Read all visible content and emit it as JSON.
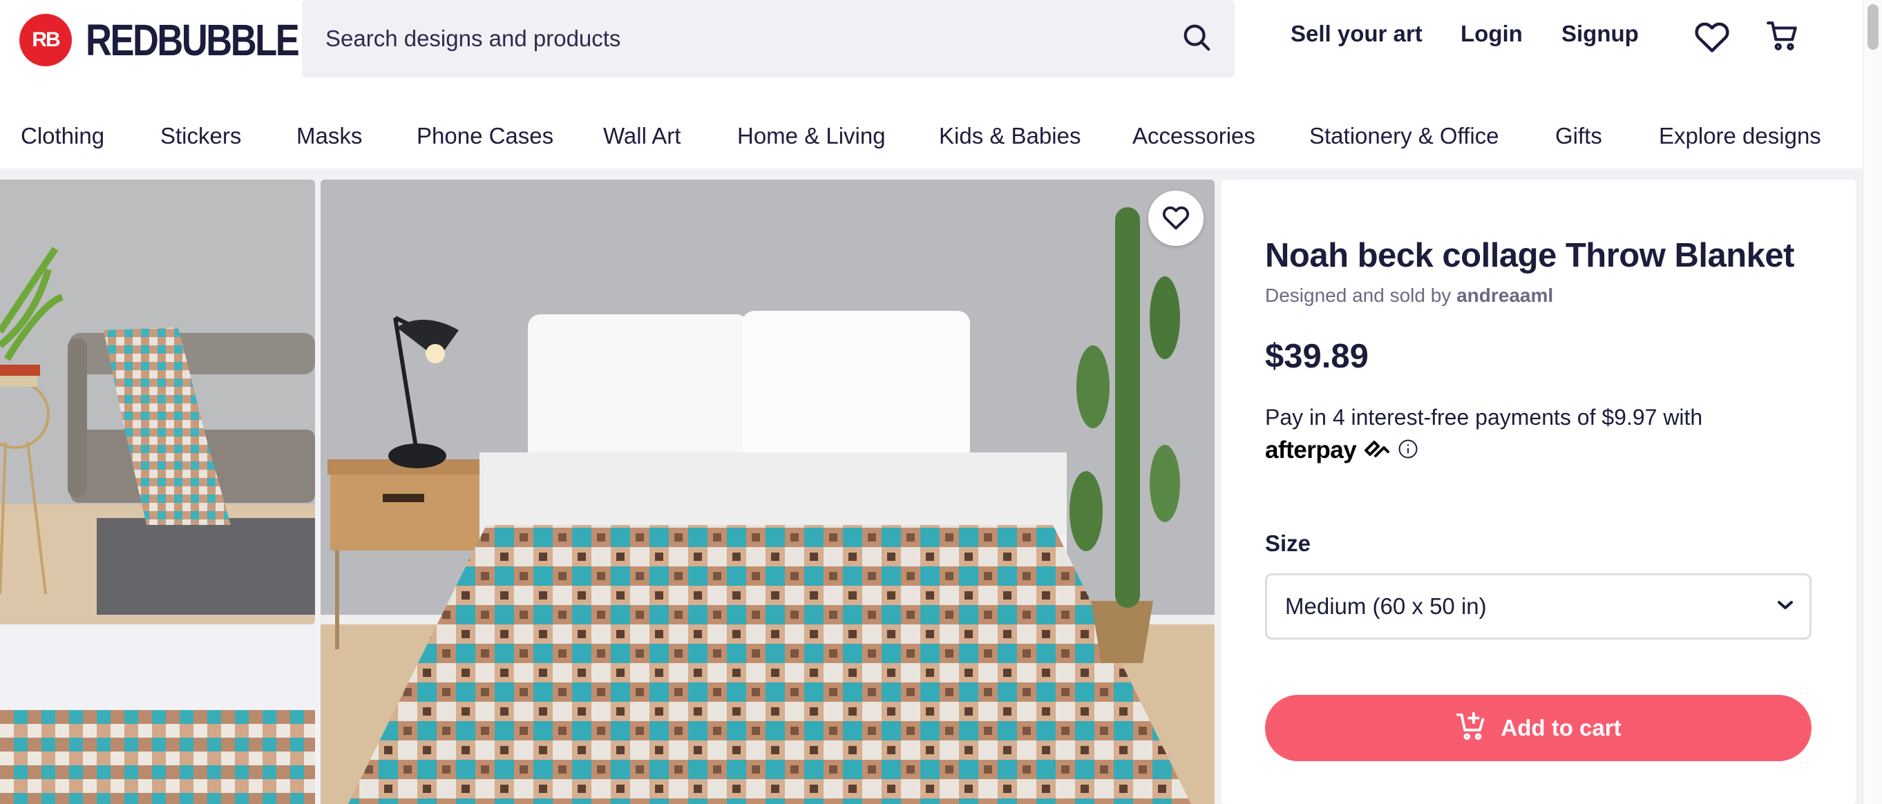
{
  "brand": {
    "mark": "RB",
    "name": "REDBUBBLE",
    "color": "#e5222b"
  },
  "search": {
    "placeholder": "Search designs and products",
    "icon": "search-icon"
  },
  "header": {
    "links": {
      "sell": "Sell your art",
      "login": "Login",
      "signup": "Signup"
    },
    "icons": [
      "heart-icon",
      "cart-icon"
    ]
  },
  "categories": [
    "Clothing",
    "Stickers",
    "Masks",
    "Phone Cases",
    "Wall Art",
    "Home & Living",
    "Kids & Babies",
    "Accessories",
    "Stationery & Office",
    "Gifts",
    "Explore designs"
  ],
  "product": {
    "title": "Noah beck collage Throw Blanket",
    "designed_prefix": "Designed and sold by",
    "artist": "andreaaml",
    "price": "$39.89",
    "payment_text": "Pay in 4 interest-free payments of $9.97 with",
    "payment_brand": "afterpay",
    "size_label": "Size",
    "size_value": "Medium (60 x 50 in)",
    "add_to_cart": "Add to cart",
    "accent_color": "#f75c6e"
  }
}
